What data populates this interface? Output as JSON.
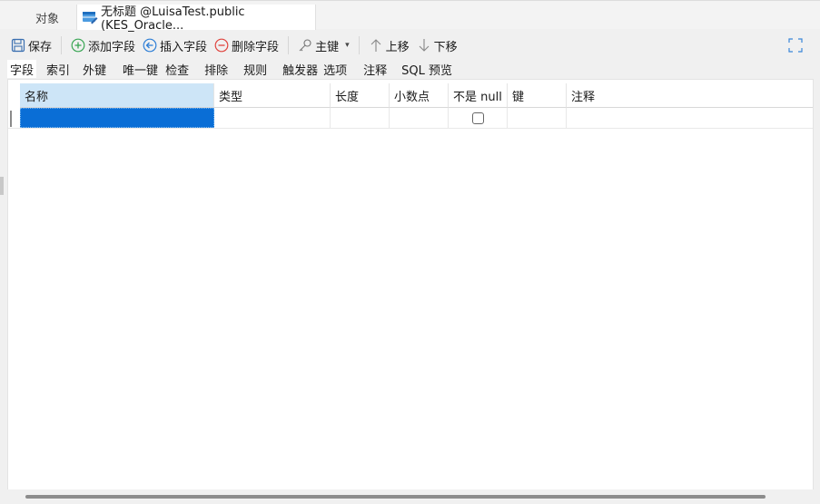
{
  "tabs": {
    "objects_label": "对象",
    "active_label": "无标题 @LuisaTest.public (KES_Oracle..."
  },
  "toolbar": {
    "save": "保存",
    "add_field": "添加字段",
    "insert_field": "插入字段",
    "delete_field": "删除字段",
    "primary_key": "主键",
    "move_up": "上移",
    "move_down": "下移"
  },
  "subtabs": [
    "字段",
    "索引",
    "外键",
    "唯一键",
    "检查",
    "排除",
    "规则",
    "触发器",
    "选项",
    "注释",
    "SQL 预览"
  ],
  "grid": {
    "columns": [
      "名称",
      "类型",
      "长度",
      "小数点",
      "不是 null",
      "键",
      "注释"
    ]
  },
  "colors": {
    "selected_cell": "#0a6ed6",
    "header_selected": "#cde5f7",
    "add_icon": "#3aa655",
    "insert_icon": "#2f7fd6",
    "delete_icon": "#e0443e"
  }
}
